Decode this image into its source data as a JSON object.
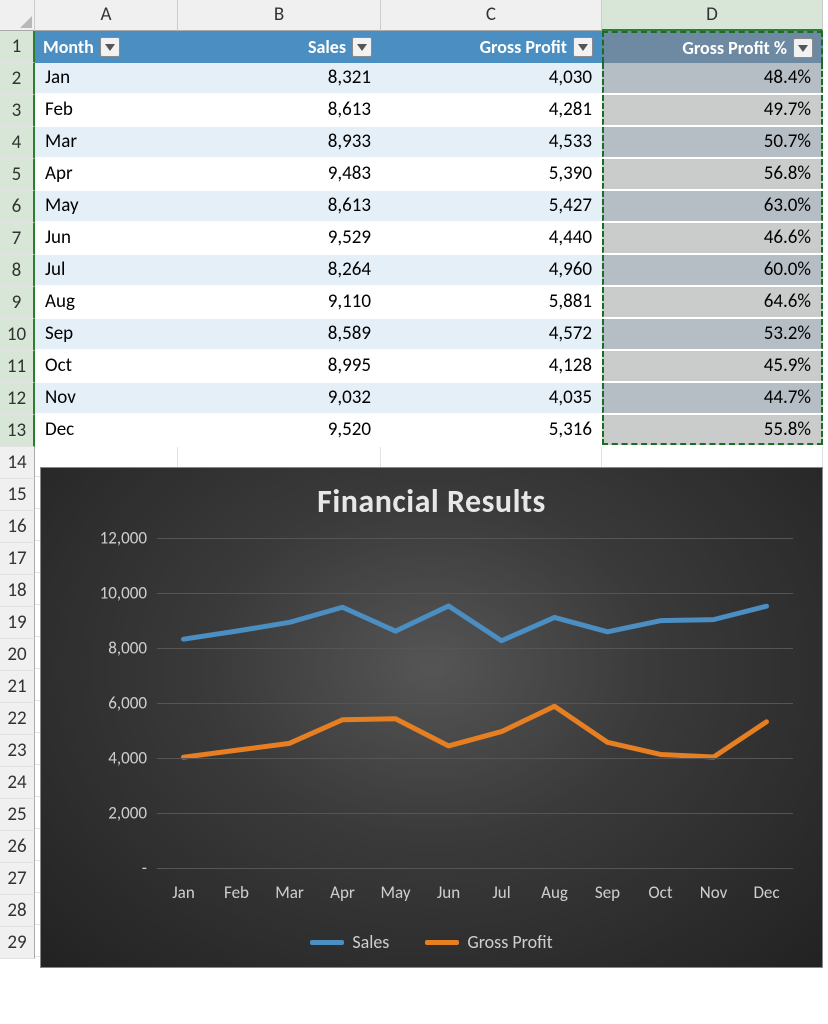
{
  "columns": [
    "A",
    "B",
    "C",
    "D"
  ],
  "row_numbers": [
    1,
    2,
    3,
    4,
    5,
    6,
    7,
    8,
    9,
    10,
    11,
    12,
    13,
    14,
    15,
    16,
    17,
    18,
    19,
    20,
    21,
    22,
    23,
    24,
    25,
    26,
    27,
    28,
    29
  ],
  "headers": {
    "month": "Month",
    "sales": "Sales",
    "gross_profit": "Gross Profit",
    "gross_profit_pct": "Gross Profit %"
  },
  "rows": [
    {
      "month": "Jan",
      "sales": "8,321",
      "gp": "4,030",
      "pct": "48.4%"
    },
    {
      "month": "Feb",
      "sales": "8,613",
      "gp": "4,281",
      "pct": "49.7%"
    },
    {
      "month": "Mar",
      "sales": "8,933",
      "gp": "4,533",
      "pct": "50.7%"
    },
    {
      "month": "Apr",
      "sales": "9,483",
      "gp": "5,390",
      "pct": "56.8%"
    },
    {
      "month": "May",
      "sales": "8,613",
      "gp": "5,427",
      "pct": "63.0%"
    },
    {
      "month": "Jun",
      "sales": "9,529",
      "gp": "4,440",
      "pct": "46.6%"
    },
    {
      "month": "Jul",
      "sales": "8,264",
      "gp": "4,960",
      "pct": "60.0%"
    },
    {
      "month": "Aug",
      "sales": "9,110",
      "gp": "5,881",
      "pct": "64.6%"
    },
    {
      "month": "Sep",
      "sales": "8,589",
      "gp": "4,572",
      "pct": "53.2%"
    },
    {
      "month": "Oct",
      "sales": "8,995",
      "gp": "4,128",
      "pct": "45.9%"
    },
    {
      "month": "Nov",
      "sales": "9,032",
      "gp": "4,035",
      "pct": "44.7%"
    },
    {
      "month": "Dec",
      "sales": "9,520",
      "gp": "5,316",
      "pct": "55.8%"
    }
  ],
  "selection": {
    "range": "D1:D13",
    "marching_ants": true
  },
  "chart_data": {
    "type": "line",
    "title": "Financial Results",
    "categories": [
      "Jan",
      "Feb",
      "Mar",
      "Apr",
      "May",
      "Jun",
      "Jul",
      "Aug",
      "Sep",
      "Oct",
      "Nov",
      "Dec"
    ],
    "series": [
      {
        "name": "Sales",
        "color": "#4a8ec2",
        "values": [
          8321,
          8613,
          8933,
          9483,
          8613,
          9529,
          8264,
          9110,
          8589,
          8995,
          9032,
          9520
        ]
      },
      {
        "name": "Gross Profit",
        "color": "#e67e22",
        "values": [
          4030,
          4281,
          4533,
          5390,
          5427,
          4440,
          4960,
          5881,
          4572,
          4128,
          4035,
          5316
        ]
      }
    ],
    "ylim": [
      0,
      12000
    ],
    "yticks": [
      0,
      2000,
      4000,
      6000,
      8000,
      10000,
      12000
    ],
    "ytick_labels": [
      "-",
      "2,000",
      "4,000",
      "6,000",
      "8,000",
      "10,000",
      "12,000"
    ],
    "xlabel": "",
    "ylabel": "",
    "grid": true,
    "legend_position": "bottom"
  }
}
